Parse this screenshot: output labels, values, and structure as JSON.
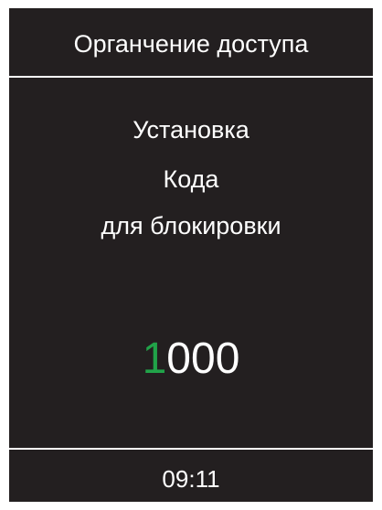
{
  "header": {
    "title": "Органчение доступа"
  },
  "message": {
    "line1": "Установка",
    "line2": "Кода",
    "line3": "для блокировки"
  },
  "code": {
    "digits": [
      "1",
      "0",
      "0",
      "0"
    ],
    "active_index": 0,
    "active_color": "#21a349"
  },
  "footer": {
    "time": "09:11"
  },
  "colors": {
    "background": "#231f20",
    "text": "#ffffff",
    "accent": "#21a349"
  }
}
